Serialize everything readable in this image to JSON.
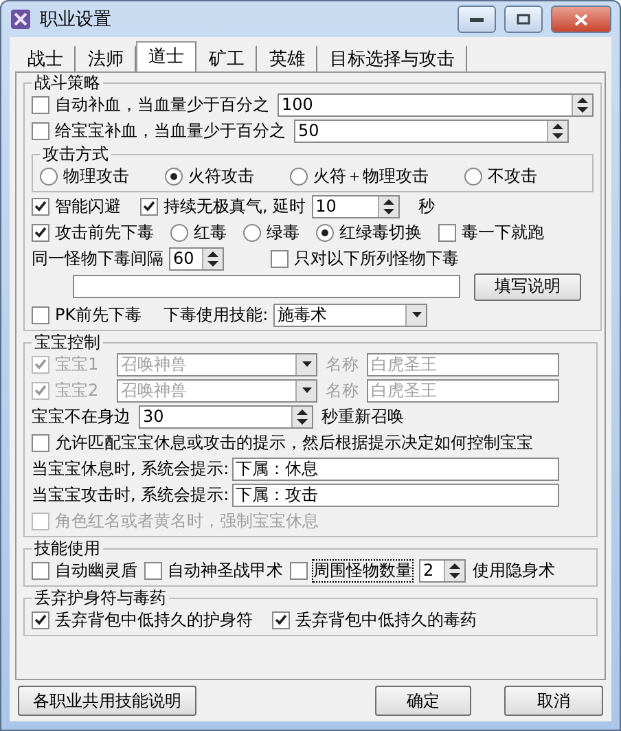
{
  "window": {
    "title": "职业设置"
  },
  "tabs": [
    {
      "label": "战士",
      "selected": false
    },
    {
      "label": "法师",
      "selected": false
    },
    {
      "label": "道士",
      "selected": true
    },
    {
      "label": "矿工",
      "selected": false
    },
    {
      "label": "英雄",
      "selected": false
    },
    {
      "label": "目标选择与攻击",
      "selected": false
    }
  ],
  "battle": {
    "legend": "战斗策略",
    "heal": [
      {
        "label": "自动补血，当血量少于百分之",
        "checked": false,
        "value": "100"
      },
      {
        "label": "给宝宝补血，当血量少于百分之",
        "checked": false,
        "value": "50"
      }
    ],
    "attack_mode": {
      "legend": "攻击方式",
      "options": [
        {
          "label": "物理攻击",
          "selected": false
        },
        {
          "label": "火符攻击",
          "selected": true
        },
        {
          "label": "火符＋物理攻击",
          "selected": false
        },
        {
          "label": "不攻击",
          "selected": false
        }
      ]
    },
    "dodge": {
      "label": "智能闪避",
      "checked": true
    },
    "qi": {
      "label": "持续无极真气, 延时",
      "checked": true,
      "value": "10",
      "unit": "秒"
    },
    "poison_first": {
      "label": "攻击前先下毒",
      "checked": true
    },
    "poison_types": [
      {
        "label": "红毒",
        "selected": false
      },
      {
        "label": "绿毒",
        "selected": false
      },
      {
        "label": "红绿毒切换",
        "selected": true
      }
    ],
    "poison_run": {
      "label": "毒一下就跑",
      "checked": false
    },
    "interval": {
      "label": "同一怪物下毒间隔",
      "value": "60"
    },
    "only_listed": {
      "label": "只对以下所列怪物下毒",
      "checked": false
    },
    "explain_button": "填写说明",
    "pk_poison": {
      "label": "PK前先下毒",
      "checked": false
    },
    "skill": {
      "label": "下毒使用技能:",
      "value": "施毒术"
    }
  },
  "pet": {
    "legend": "宝宝控制",
    "pets": [
      {
        "label": "宝宝1",
        "checked": true,
        "disabled": true,
        "skill": "召唤神兽",
        "name_label": "名称",
        "name": "白虎圣王"
      },
      {
        "label": "宝宝2",
        "checked": true,
        "disabled": true,
        "skill": "召唤神兽",
        "name_label": "名称",
        "name": "白虎圣王"
      }
    ],
    "absent": {
      "label": "宝宝不在身边",
      "value": "30",
      "suffix": "秒重新召唤"
    },
    "allow": {
      "label": "允许匹配宝宝休息或攻击的提示，然后根据提示决定如何控制宝宝",
      "checked": false
    },
    "prompts": [
      {
        "label": "当宝宝休息时, 系统会提示:",
        "value": "下属：休息"
      },
      {
        "label": "当宝宝攻击时, 系统会提示:",
        "value": "下属：攻击"
      }
    ],
    "force_rest": {
      "label": "角色红名或者黄名时，强制宝宝休息",
      "checked": false,
      "disabled": true
    }
  },
  "skills": {
    "legend": "技能使用",
    "items": [
      {
        "label": "自动幽灵盾",
        "checked": false
      },
      {
        "label": "自动神圣战甲术",
        "checked": false
      },
      {
        "label": "周围怪物数量",
        "checked": false,
        "focused": true
      }
    ],
    "count": "2",
    "suffix": "使用隐身术"
  },
  "discard": {
    "legend": "丢弃护身符与毒药",
    "items": [
      {
        "label": "丢弃背包中低持久的护身符",
        "checked": true
      },
      {
        "label": "丢弃背包中低持久的毒药",
        "checked": true
      }
    ]
  },
  "buttons": [
    "各职业共用技能说明",
    "确定",
    "取消"
  ]
}
